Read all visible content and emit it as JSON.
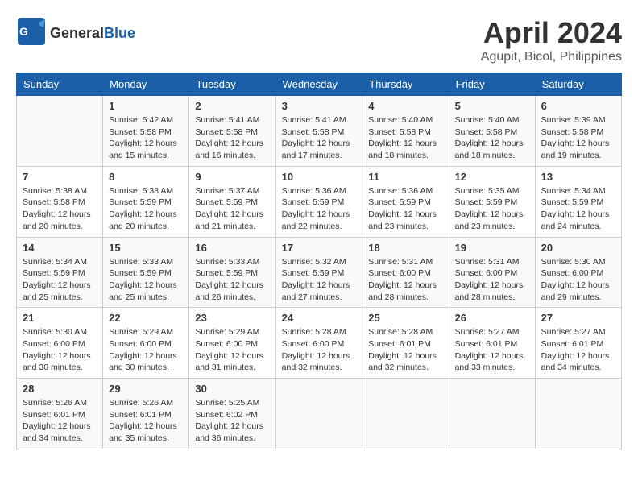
{
  "header": {
    "logo_general": "General",
    "logo_blue": "Blue",
    "title": "April 2024",
    "subtitle": "Agupit, Bicol, Philippines"
  },
  "calendar": {
    "days_of_week": [
      "Sunday",
      "Monday",
      "Tuesday",
      "Wednesday",
      "Thursday",
      "Friday",
      "Saturday"
    ],
    "weeks": [
      [
        {
          "day": "",
          "info": ""
        },
        {
          "day": "1",
          "info": "Sunrise: 5:42 AM\nSunset: 5:58 PM\nDaylight: 12 hours\nand 15 minutes."
        },
        {
          "day": "2",
          "info": "Sunrise: 5:41 AM\nSunset: 5:58 PM\nDaylight: 12 hours\nand 16 minutes."
        },
        {
          "day": "3",
          "info": "Sunrise: 5:41 AM\nSunset: 5:58 PM\nDaylight: 12 hours\nand 17 minutes."
        },
        {
          "day": "4",
          "info": "Sunrise: 5:40 AM\nSunset: 5:58 PM\nDaylight: 12 hours\nand 18 minutes."
        },
        {
          "day": "5",
          "info": "Sunrise: 5:40 AM\nSunset: 5:58 PM\nDaylight: 12 hours\nand 18 minutes."
        },
        {
          "day": "6",
          "info": "Sunrise: 5:39 AM\nSunset: 5:58 PM\nDaylight: 12 hours\nand 19 minutes."
        }
      ],
      [
        {
          "day": "7",
          "info": "Sunrise: 5:38 AM\nSunset: 5:58 PM\nDaylight: 12 hours\nand 20 minutes."
        },
        {
          "day": "8",
          "info": "Sunrise: 5:38 AM\nSunset: 5:59 PM\nDaylight: 12 hours\nand 20 minutes."
        },
        {
          "day": "9",
          "info": "Sunrise: 5:37 AM\nSunset: 5:59 PM\nDaylight: 12 hours\nand 21 minutes."
        },
        {
          "day": "10",
          "info": "Sunrise: 5:36 AM\nSunset: 5:59 PM\nDaylight: 12 hours\nand 22 minutes."
        },
        {
          "day": "11",
          "info": "Sunrise: 5:36 AM\nSunset: 5:59 PM\nDaylight: 12 hours\nand 23 minutes."
        },
        {
          "day": "12",
          "info": "Sunrise: 5:35 AM\nSunset: 5:59 PM\nDaylight: 12 hours\nand 23 minutes."
        },
        {
          "day": "13",
          "info": "Sunrise: 5:34 AM\nSunset: 5:59 PM\nDaylight: 12 hours\nand 24 minutes."
        }
      ],
      [
        {
          "day": "14",
          "info": "Sunrise: 5:34 AM\nSunset: 5:59 PM\nDaylight: 12 hours\nand 25 minutes."
        },
        {
          "day": "15",
          "info": "Sunrise: 5:33 AM\nSunset: 5:59 PM\nDaylight: 12 hours\nand 25 minutes."
        },
        {
          "day": "16",
          "info": "Sunrise: 5:33 AM\nSunset: 5:59 PM\nDaylight: 12 hours\nand 26 minutes."
        },
        {
          "day": "17",
          "info": "Sunrise: 5:32 AM\nSunset: 5:59 PM\nDaylight: 12 hours\nand 27 minutes."
        },
        {
          "day": "18",
          "info": "Sunrise: 5:31 AM\nSunset: 6:00 PM\nDaylight: 12 hours\nand 28 minutes."
        },
        {
          "day": "19",
          "info": "Sunrise: 5:31 AM\nSunset: 6:00 PM\nDaylight: 12 hours\nand 28 minutes."
        },
        {
          "day": "20",
          "info": "Sunrise: 5:30 AM\nSunset: 6:00 PM\nDaylight: 12 hours\nand 29 minutes."
        }
      ],
      [
        {
          "day": "21",
          "info": "Sunrise: 5:30 AM\nSunset: 6:00 PM\nDaylight: 12 hours\nand 30 minutes."
        },
        {
          "day": "22",
          "info": "Sunrise: 5:29 AM\nSunset: 6:00 PM\nDaylight: 12 hours\nand 30 minutes."
        },
        {
          "day": "23",
          "info": "Sunrise: 5:29 AM\nSunset: 6:00 PM\nDaylight: 12 hours\nand 31 minutes."
        },
        {
          "day": "24",
          "info": "Sunrise: 5:28 AM\nSunset: 6:00 PM\nDaylight: 12 hours\nand 32 minutes."
        },
        {
          "day": "25",
          "info": "Sunrise: 5:28 AM\nSunset: 6:01 PM\nDaylight: 12 hours\nand 32 minutes."
        },
        {
          "day": "26",
          "info": "Sunrise: 5:27 AM\nSunset: 6:01 PM\nDaylight: 12 hours\nand 33 minutes."
        },
        {
          "day": "27",
          "info": "Sunrise: 5:27 AM\nSunset: 6:01 PM\nDaylight: 12 hours\nand 34 minutes."
        }
      ],
      [
        {
          "day": "28",
          "info": "Sunrise: 5:26 AM\nSunset: 6:01 PM\nDaylight: 12 hours\nand 34 minutes."
        },
        {
          "day": "29",
          "info": "Sunrise: 5:26 AM\nSunset: 6:01 PM\nDaylight: 12 hours\nand 35 minutes."
        },
        {
          "day": "30",
          "info": "Sunrise: 5:25 AM\nSunset: 6:02 PM\nDaylight: 12 hours\nand 36 minutes."
        },
        {
          "day": "",
          "info": ""
        },
        {
          "day": "",
          "info": ""
        },
        {
          "day": "",
          "info": ""
        },
        {
          "day": "",
          "info": ""
        }
      ]
    ]
  }
}
